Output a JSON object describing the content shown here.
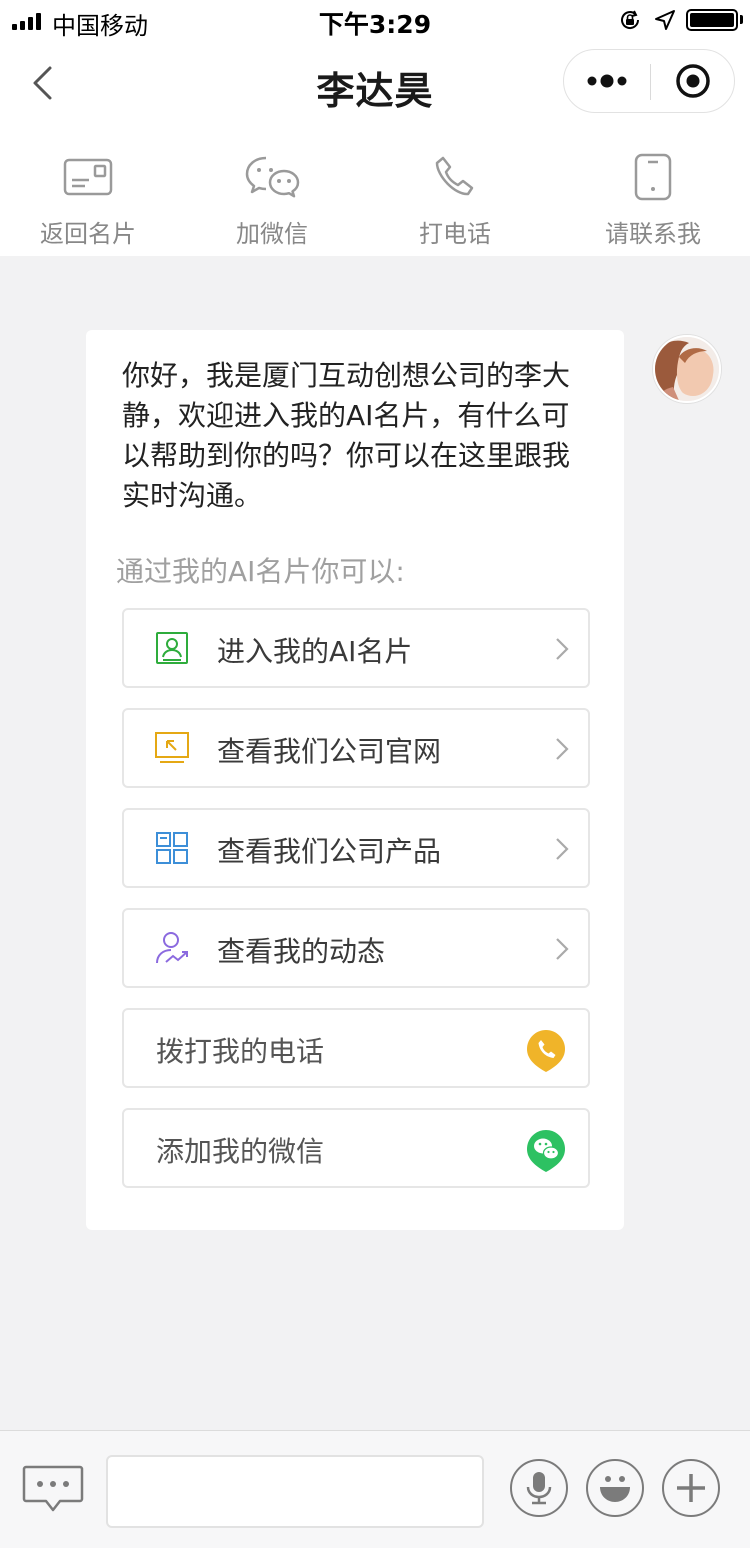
{
  "status_bar": {
    "carrier": "中国移动",
    "time": "下午3:29",
    "battery_level": 1.0
  },
  "nav": {
    "title": "李达昊",
    "back_icon": "chevron-left-icon",
    "more_icon": "more-dots-icon",
    "close_icon": "target-close-icon"
  },
  "quick_actions": [
    {
      "label": "返回名片",
      "icon": "business-card-icon"
    },
    {
      "label": "加微信",
      "icon": "wechat-icon"
    },
    {
      "label": "打电话",
      "icon": "phone-icon"
    },
    {
      "label": "请联系我",
      "icon": "mobile-phone-icon"
    }
  ],
  "chat": {
    "greeting": "你好，我是厦门互动创想公司的李大静，欢迎进入我的AI名片，有什么可以帮助到你的吗？你可以在这里跟我实时沟通。",
    "intro": "通过我的AI名片你可以:",
    "options": [
      {
        "label": "进入我的AI名片",
        "icon": "id-card-icon",
        "color": "#2eac3c"
      },
      {
        "label": "查看我们公司官网",
        "icon": "website-icon",
        "color": "#e5a814"
      },
      {
        "label": "查看我们公司产品",
        "icon": "grid-icon",
        "color": "#3d8fd8"
      },
      {
        "label": "查看我的动态",
        "icon": "user-trend-icon",
        "color": "#8b6adf"
      },
      {
        "label": "拨打我的电话",
        "icon": "phone-badge-icon",
        "color": "#f0b429"
      },
      {
        "label": "添加我的微信",
        "icon": "wechat-badge-icon",
        "color": "#2dc162"
      }
    ]
  },
  "input_bar": {
    "placeholder": "",
    "keyboard_icon": "chat-bubble-icon",
    "voice_icon": "microphone-icon",
    "emoji_icon": "smiley-icon",
    "plus_icon": "plus-icon"
  }
}
